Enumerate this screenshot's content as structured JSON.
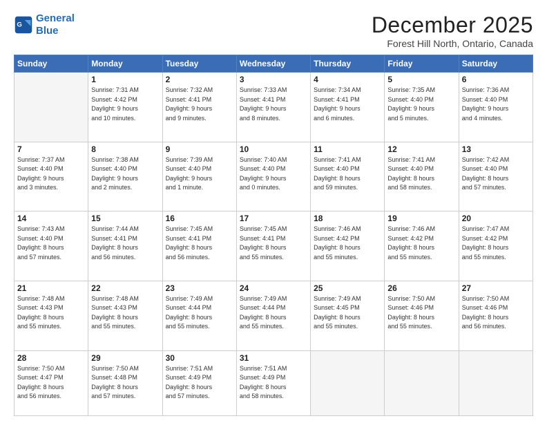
{
  "header": {
    "logo_line1": "General",
    "logo_line2": "Blue",
    "month": "December 2025",
    "location": "Forest Hill North, Ontario, Canada"
  },
  "weekdays": [
    "Sunday",
    "Monday",
    "Tuesday",
    "Wednesday",
    "Thursday",
    "Friday",
    "Saturday"
  ],
  "weeks": [
    [
      {
        "day": "",
        "info": ""
      },
      {
        "day": "1",
        "info": "Sunrise: 7:31 AM\nSunset: 4:42 PM\nDaylight: 9 hours\nand 10 minutes."
      },
      {
        "day": "2",
        "info": "Sunrise: 7:32 AM\nSunset: 4:41 PM\nDaylight: 9 hours\nand 9 minutes."
      },
      {
        "day": "3",
        "info": "Sunrise: 7:33 AM\nSunset: 4:41 PM\nDaylight: 9 hours\nand 8 minutes."
      },
      {
        "day": "4",
        "info": "Sunrise: 7:34 AM\nSunset: 4:41 PM\nDaylight: 9 hours\nand 6 minutes."
      },
      {
        "day": "5",
        "info": "Sunrise: 7:35 AM\nSunset: 4:40 PM\nDaylight: 9 hours\nand 5 minutes."
      },
      {
        "day": "6",
        "info": "Sunrise: 7:36 AM\nSunset: 4:40 PM\nDaylight: 9 hours\nand 4 minutes."
      }
    ],
    [
      {
        "day": "7",
        "info": "Sunrise: 7:37 AM\nSunset: 4:40 PM\nDaylight: 9 hours\nand 3 minutes."
      },
      {
        "day": "8",
        "info": "Sunrise: 7:38 AM\nSunset: 4:40 PM\nDaylight: 9 hours\nand 2 minutes."
      },
      {
        "day": "9",
        "info": "Sunrise: 7:39 AM\nSunset: 4:40 PM\nDaylight: 9 hours\nand 1 minute."
      },
      {
        "day": "10",
        "info": "Sunrise: 7:40 AM\nSunset: 4:40 PM\nDaylight: 9 hours\nand 0 minutes."
      },
      {
        "day": "11",
        "info": "Sunrise: 7:41 AM\nSunset: 4:40 PM\nDaylight: 8 hours\nand 59 minutes."
      },
      {
        "day": "12",
        "info": "Sunrise: 7:41 AM\nSunset: 4:40 PM\nDaylight: 8 hours\nand 58 minutes."
      },
      {
        "day": "13",
        "info": "Sunrise: 7:42 AM\nSunset: 4:40 PM\nDaylight: 8 hours\nand 57 minutes."
      }
    ],
    [
      {
        "day": "14",
        "info": "Sunrise: 7:43 AM\nSunset: 4:40 PM\nDaylight: 8 hours\nand 57 minutes."
      },
      {
        "day": "15",
        "info": "Sunrise: 7:44 AM\nSunset: 4:41 PM\nDaylight: 8 hours\nand 56 minutes."
      },
      {
        "day": "16",
        "info": "Sunrise: 7:45 AM\nSunset: 4:41 PM\nDaylight: 8 hours\nand 56 minutes."
      },
      {
        "day": "17",
        "info": "Sunrise: 7:45 AM\nSunset: 4:41 PM\nDaylight: 8 hours\nand 55 minutes."
      },
      {
        "day": "18",
        "info": "Sunrise: 7:46 AM\nSunset: 4:42 PM\nDaylight: 8 hours\nand 55 minutes."
      },
      {
        "day": "19",
        "info": "Sunrise: 7:46 AM\nSunset: 4:42 PM\nDaylight: 8 hours\nand 55 minutes."
      },
      {
        "day": "20",
        "info": "Sunrise: 7:47 AM\nSunset: 4:42 PM\nDaylight: 8 hours\nand 55 minutes."
      }
    ],
    [
      {
        "day": "21",
        "info": "Sunrise: 7:48 AM\nSunset: 4:43 PM\nDaylight: 8 hours\nand 55 minutes."
      },
      {
        "day": "22",
        "info": "Sunrise: 7:48 AM\nSunset: 4:43 PM\nDaylight: 8 hours\nand 55 minutes."
      },
      {
        "day": "23",
        "info": "Sunrise: 7:49 AM\nSunset: 4:44 PM\nDaylight: 8 hours\nand 55 minutes."
      },
      {
        "day": "24",
        "info": "Sunrise: 7:49 AM\nSunset: 4:44 PM\nDaylight: 8 hours\nand 55 minutes."
      },
      {
        "day": "25",
        "info": "Sunrise: 7:49 AM\nSunset: 4:45 PM\nDaylight: 8 hours\nand 55 minutes."
      },
      {
        "day": "26",
        "info": "Sunrise: 7:50 AM\nSunset: 4:46 PM\nDaylight: 8 hours\nand 55 minutes."
      },
      {
        "day": "27",
        "info": "Sunrise: 7:50 AM\nSunset: 4:46 PM\nDaylight: 8 hours\nand 56 minutes."
      }
    ],
    [
      {
        "day": "28",
        "info": "Sunrise: 7:50 AM\nSunset: 4:47 PM\nDaylight: 8 hours\nand 56 minutes."
      },
      {
        "day": "29",
        "info": "Sunrise: 7:50 AM\nSunset: 4:48 PM\nDaylight: 8 hours\nand 57 minutes."
      },
      {
        "day": "30",
        "info": "Sunrise: 7:51 AM\nSunset: 4:49 PM\nDaylight: 8 hours\nand 57 minutes."
      },
      {
        "day": "31",
        "info": "Sunrise: 7:51 AM\nSunset: 4:49 PM\nDaylight: 8 hours\nand 58 minutes."
      },
      {
        "day": "",
        "info": ""
      },
      {
        "day": "",
        "info": ""
      },
      {
        "day": "",
        "info": ""
      }
    ]
  ]
}
